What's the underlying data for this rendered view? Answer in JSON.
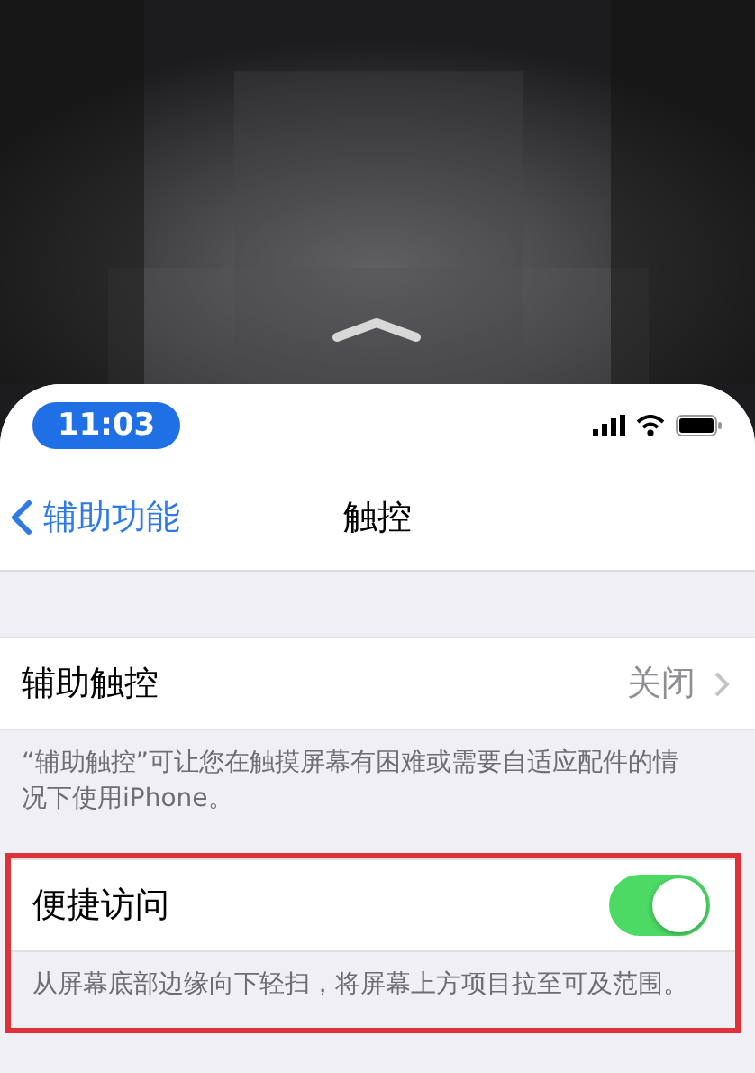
{
  "status_bar": {
    "time": "11:03"
  },
  "nav": {
    "back": "辅助功能",
    "title": "触控"
  },
  "groups": [
    {
      "highlighted": false,
      "row": {
        "kind": "value",
        "label": "辅助触控",
        "value": "关闭"
      },
      "footer": "“辅助触控”可让您在触摸屏幕有困难或需要自适应配件的情况下使用iPhone。"
    },
    {
      "highlighted": true,
      "row": {
        "kind": "switch",
        "label": "便捷访问",
        "on": true
      },
      "footer": "从屏幕底部边缘向下轻扫，将屏幕上方项目拉至可及范围。"
    }
  ]
}
